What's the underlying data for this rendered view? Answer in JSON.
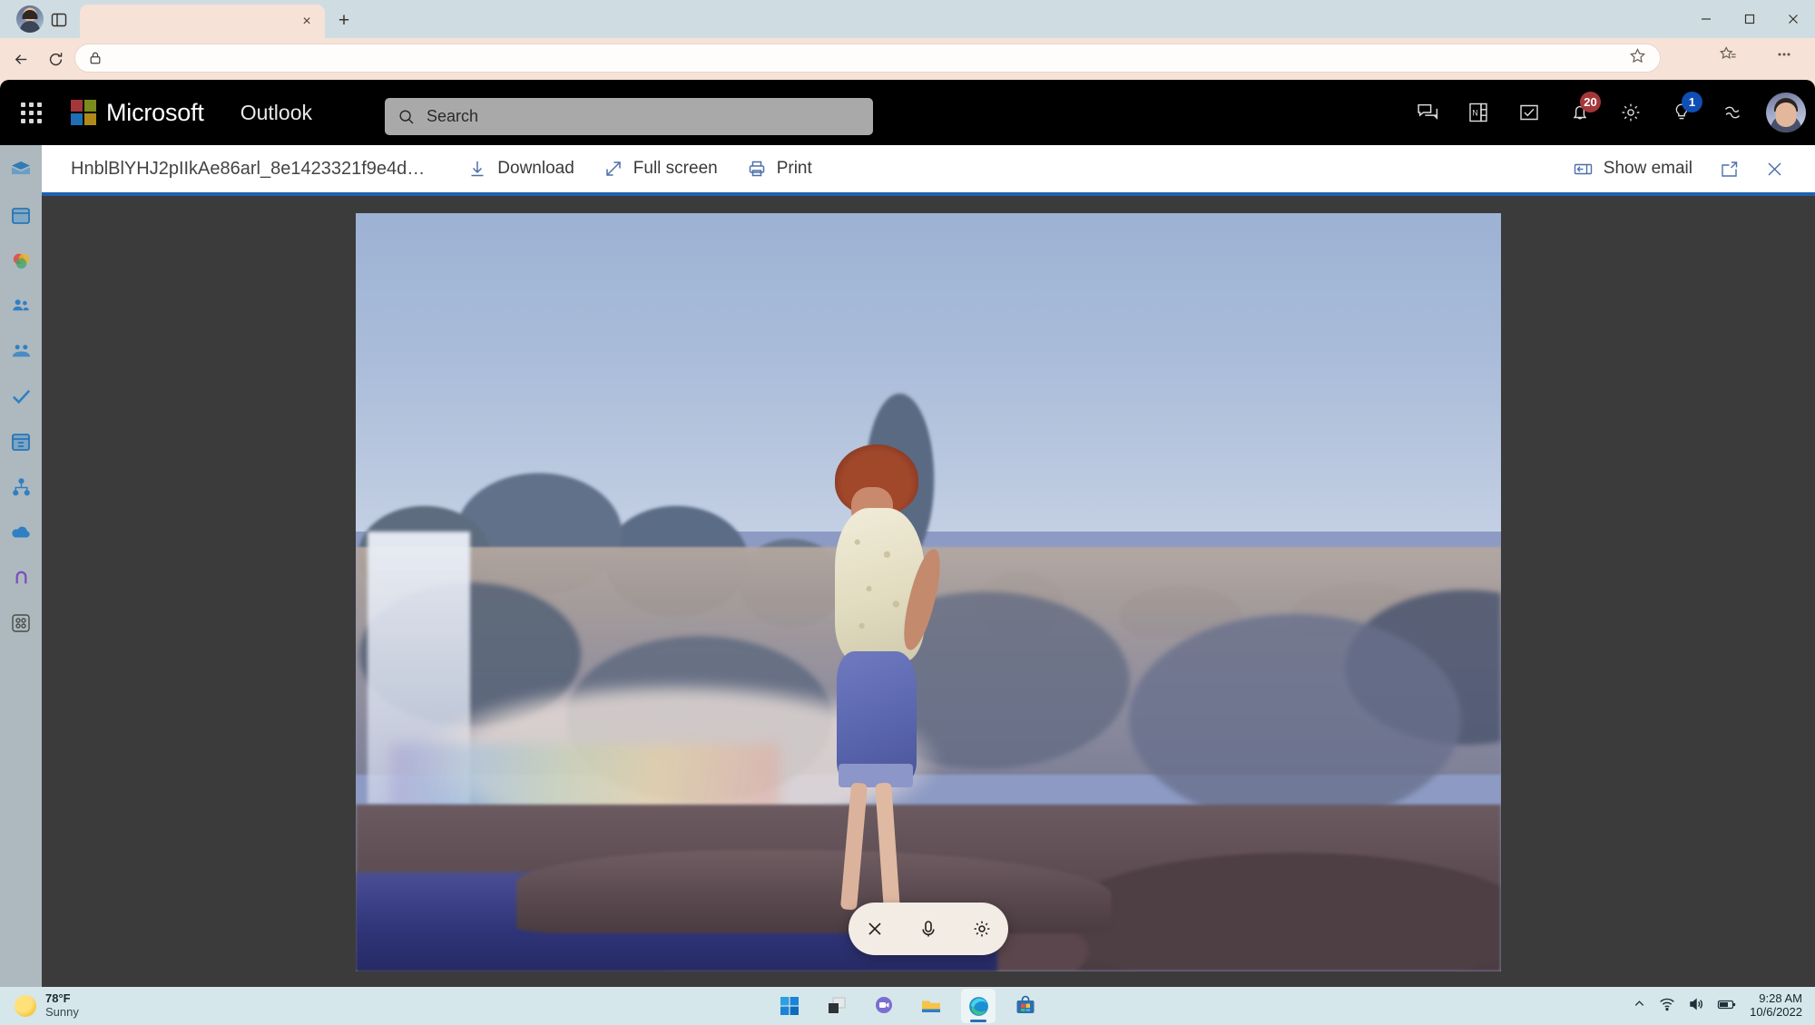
{
  "window": {
    "minimize_label": "Minimize",
    "maximize_label": "Maximize",
    "close_label": "Close"
  },
  "browser": {
    "tab_title": "",
    "tab_close_label": "×",
    "new_tab_label": "+",
    "back_label": "Back",
    "refresh_label": "Refresh",
    "address_value": "",
    "lock_icon": "lock-icon",
    "favorite_icon": "star-icon",
    "collections_icon": "collections-icon",
    "settings_icon": "ellipsis-icon"
  },
  "owa": {
    "brand": "Microsoft",
    "app_name": "Outlook",
    "search_placeholder": "Search",
    "search_value": "",
    "icons": [
      {
        "name": "teams-chat-icon",
        "badge": ""
      },
      {
        "name": "onenote-icon",
        "badge": ""
      },
      {
        "name": "todo-icon",
        "badge": ""
      },
      {
        "name": "notifications-icon",
        "badge": "20",
        "badge_color": "#a4373a"
      },
      {
        "name": "settings-gear-icon",
        "badge": ""
      },
      {
        "name": "tips-bulb-icon",
        "badge": "1",
        "badge_color": "#0f4fb5"
      },
      {
        "name": "copilot-icon",
        "badge": ""
      }
    ]
  },
  "rail": {
    "items": [
      {
        "name": "sidebar-item-mail",
        "label": "Mail"
      },
      {
        "name": "sidebar-item-calendar",
        "label": "Calendar"
      },
      {
        "name": "sidebar-item-copilot",
        "label": "Copilot"
      },
      {
        "name": "sidebar-item-people",
        "label": "People"
      },
      {
        "name": "sidebar-item-groups",
        "label": "Groups"
      },
      {
        "name": "sidebar-item-todo",
        "label": "To Do"
      },
      {
        "name": "sidebar-item-bookings",
        "label": "Bookings"
      },
      {
        "name": "sidebar-item-viva",
        "label": "Viva"
      },
      {
        "name": "sidebar-item-onedrive",
        "label": "OneDrive"
      },
      {
        "name": "sidebar-item-loop",
        "label": "Loop"
      },
      {
        "name": "sidebar-item-apps",
        "label": "More apps"
      }
    ]
  },
  "viewer": {
    "file_name": "HnblBlYHJ2pIIkAe86arl_8e1423321f9e4d…",
    "download_label": "Download",
    "fullscreen_label": "Full screen",
    "print_label": "Print",
    "show_email_label": "Show email",
    "popout_label": "Open in new window",
    "close_label": "Close",
    "accent_color": "#1f62b0",
    "background_color": "#3b3b3b"
  },
  "photo": {
    "description": "Vintage color photograph of a woman with red hair in a white patterned blouse and blue rolled capri trousers standing on dark rocks at the edge of a river, with a waterfall, rainbow in the mist, cliffs and trees behind her."
  },
  "overlay": {
    "close_label": "Close",
    "microphone_label": "Microphone",
    "settings_label": "Settings"
  },
  "taskbar": {
    "weather_temp": "78°F",
    "weather_condition": "Sunny",
    "apps": [
      {
        "name": "start-button",
        "label": "Start"
      },
      {
        "name": "task-view-button",
        "label": "Task view"
      },
      {
        "name": "teams-chat-button",
        "label": "Chat"
      },
      {
        "name": "file-explorer-button",
        "label": "File Explorer"
      },
      {
        "name": "edge-button",
        "label": "Microsoft Edge",
        "active": true
      },
      {
        "name": "store-button",
        "label": "Microsoft Store"
      }
    ],
    "tray": {
      "chevron_label": "Show hidden icons",
      "network_label": "Network",
      "volume_label": "Volume",
      "battery_label": "Battery",
      "time": "9:28 AM",
      "date": "10/6/2022"
    }
  }
}
